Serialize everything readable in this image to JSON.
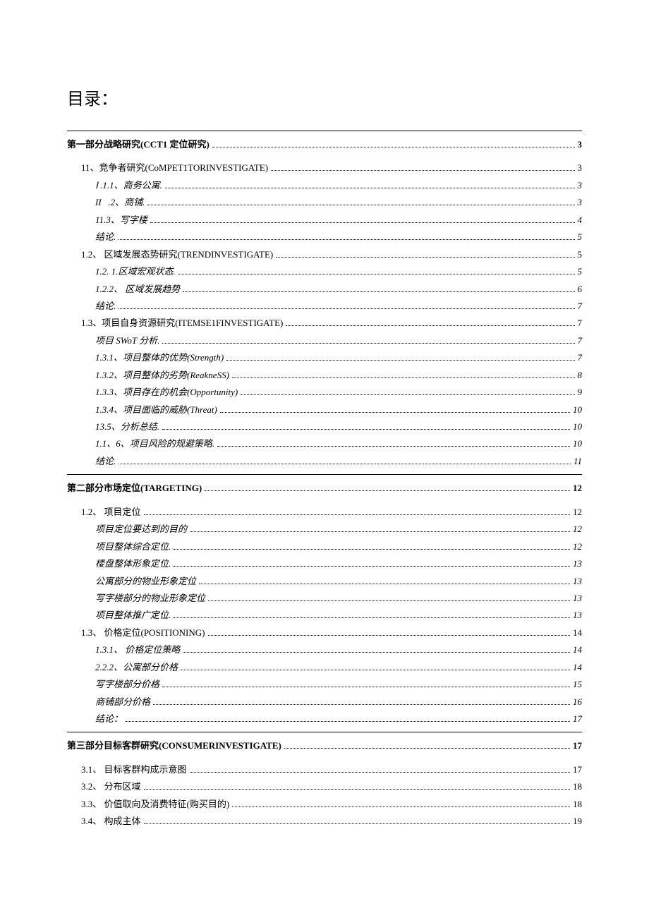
{
  "title": "目录：",
  "entries": [
    {
      "level": 1,
      "label": "第一部分战略研究(CCT1 定位研究)",
      "page": "3",
      "sep_before": true,
      "bold": true
    },
    {
      "level": 2,
      "label": "11、竞争者研究(CoMPET1TORINVESTIGATE)",
      "page": "3",
      "gap_before": true
    },
    {
      "level": 3,
      "label": "Ⅰ .1.1、商务公寓.",
      "page": "3",
      "italic": true
    },
    {
      "level": 3,
      "label": "II   .2、商铺.",
      "page": "3",
      "italic": true
    },
    {
      "level": 3,
      "label": "11.3、写字楼",
      "page": "4",
      "italic": true
    },
    {
      "level": 3,
      "label": "结论.",
      "page": "5",
      "italic": true
    },
    {
      "level": 2,
      "label": "1.2、 区域发展态势研究(TRENDINVESTIGATE)",
      "page": "5"
    },
    {
      "level": 3,
      "label": "1.2. 1.区域宏观状态.",
      "page": "5",
      "italic": true
    },
    {
      "level": 3,
      "label": "1.2.2、 区域发展趋势",
      "page": "6",
      "italic": true
    },
    {
      "level": 3,
      "label": "结论.",
      "page": "7",
      "italic": true
    },
    {
      "level": 2,
      "label": "1.3、项目自身资源研究(ITEMSE1FINVESTIGATE)",
      "page": "7"
    },
    {
      "level": 3,
      "label": "项目 SWoT 分析.",
      "page": "7",
      "italic": true
    },
    {
      "level": 3,
      "label": "1.3.1、项目整体的优势(Strength)",
      "page": "7",
      "italic": true
    },
    {
      "level": 3,
      "label": "1.3.2、项目整体的劣势(ReakneSS)",
      "page": "8",
      "italic": true
    },
    {
      "level": 3,
      "label": "1.3.3、项目存在的机会(Opportunity)",
      "page": "9",
      "italic": true
    },
    {
      "level": 3,
      "label": "1.3.4、项目面临的威胁(Threat)",
      "page": "10",
      "italic": true
    },
    {
      "level": 3,
      "label": "13.5、分析总结.",
      "page": "10",
      "italic": true
    },
    {
      "level": 3,
      "label": "1.1、6、项目风险的规避策略.",
      "page": "10"
    },
    {
      "level": 3,
      "label": "结论.",
      "page": "11",
      "italic": true
    },
    {
      "level": 1,
      "label": "第二部分市场定位(TARGETING)",
      "page": "12",
      "sep_before": true,
      "bold": true
    },
    {
      "level": 2,
      "label": "1.2、 项目定位",
      "page": "12",
      "gap_before": true
    },
    {
      "level": 3,
      "label": "项目定位要达到的目的",
      "page": "12",
      "italic": true
    },
    {
      "level": 3,
      "label": "项目整体综合定位.",
      "page": "12",
      "italic": true
    },
    {
      "level": 3,
      "label": "楼盘整体形象定位.",
      "page": "13",
      "italic": true
    },
    {
      "level": 3,
      "label": "公寓部分的物业形象定位",
      "page": "13",
      "italic": true
    },
    {
      "level": 3,
      "label": "写字楼部分的物业形象定位",
      "page": "13",
      "italic": true
    },
    {
      "level": 3,
      "label": "项目整体推广定位.",
      "page": "13",
      "italic": true
    },
    {
      "level": 2,
      "label": "1.3、 价格定位(POSITIONING)",
      "page": "14"
    },
    {
      "level": 3,
      "label": "1.3.1、 价格定位策略",
      "page": "14",
      "italic": true
    },
    {
      "level": 3,
      "label": "2.2.2、公寓部分价格",
      "page": "14",
      "italic": true
    },
    {
      "level": 3,
      "label": "写字楼部分价格",
      "page": "15",
      "italic": true
    },
    {
      "level": 3,
      "label": "商铺部分价格",
      "page": "16",
      "italic": true
    },
    {
      "level": 3,
      "label": "结论：",
      "page": "17",
      "italic": true
    },
    {
      "level": 1,
      "label": "第三部分目标客群研究(CONSUMERINVESTIGATE)",
      "page": "17",
      "sep_before": true,
      "bold": true
    },
    {
      "level": 2,
      "label": "3.1、 目标客群构成示意图",
      "page": "17",
      "gap_before": true
    },
    {
      "level": 2,
      "label": "3.2、 分布区域",
      "page": "18"
    },
    {
      "level": 2,
      "label": "3.3、 价值取向及消费特征(购买目的)",
      "page": "18"
    },
    {
      "level": 2,
      "label": "3.4、 构成主体",
      "page": "19"
    }
  ]
}
